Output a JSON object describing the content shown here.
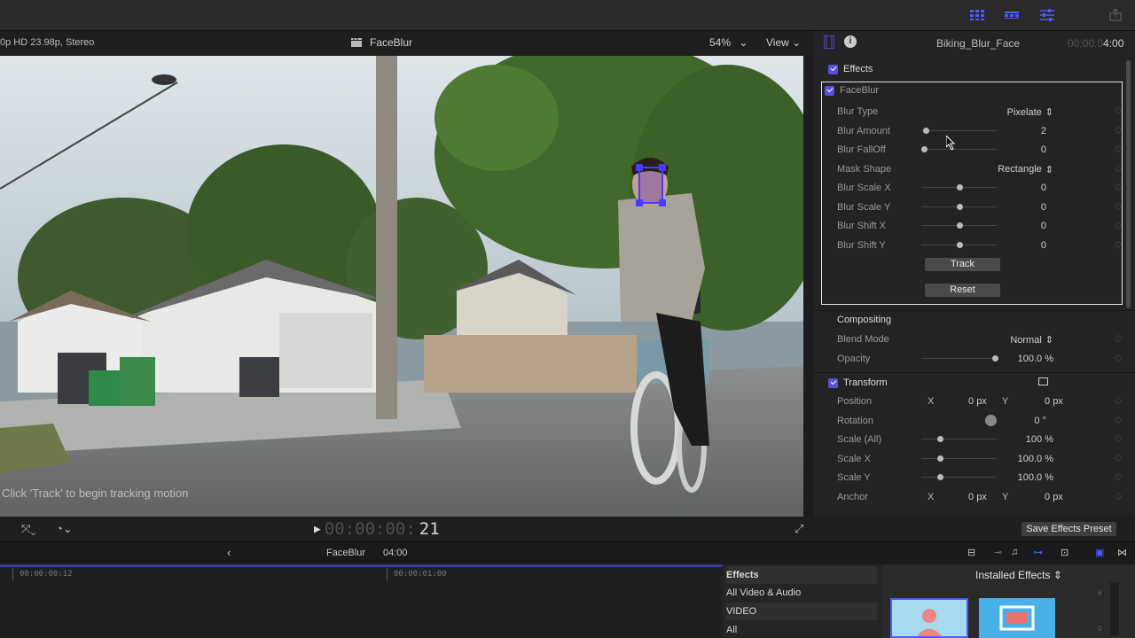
{
  "viewer": {
    "format": "0p HD 23.98p, Stereo",
    "clip_title": "FaceBlur",
    "zoom": "54%",
    "view_label": "View",
    "hint": "Click 'Track' to begin tracking motion",
    "timecode_dim": "00:00:00:",
    "timecode_frames": "21"
  },
  "inspector": {
    "title": "Biking_Blur_Face",
    "duration_dim": "00:00:0",
    "duration": "4:00",
    "effects_label": "Effects",
    "effect_name": "FaceBlur",
    "params": [
      {
        "label": "Blur Type",
        "value": "Pixelate",
        "kind": "popup"
      },
      {
        "label": "Blur Amount",
        "value": "2",
        "kind": "slider",
        "level": 0.02
      },
      {
        "label": "Blur FallOff",
        "value": "0",
        "kind": "slider",
        "level": 0.0
      },
      {
        "label": "Mask Shape",
        "value": "Rectangle",
        "kind": "popup"
      },
      {
        "label": "Blur Scale X",
        "value": "0",
        "kind": "slider",
        "level": 0.5
      },
      {
        "label": "Blur Scale Y",
        "value": "0",
        "kind": "slider",
        "level": 0.5
      },
      {
        "label": "Blur Shift X",
        "value": "0",
        "kind": "slider",
        "level": 0.5
      },
      {
        "label": "Blur Shift Y",
        "value": "0",
        "kind": "slider",
        "level": 0.5
      }
    ],
    "track_label": "Track",
    "reset_label": "Reset",
    "compositing_label": "Compositing",
    "blend_mode_label": "Blend Mode",
    "blend_mode_value": "Normal",
    "opacity_label": "Opacity",
    "opacity_value": "100.0",
    "opacity_unit": "%",
    "transform_label": "Transform",
    "position_label": "Position",
    "position_x_label": "X",
    "position_x": "0",
    "position_y_label": "Y",
    "position_y": "0",
    "px_unit": "px",
    "rotation_label": "Rotation",
    "rotation_value": "0",
    "rotation_unit": "°",
    "scale_all_label": "Scale (All)",
    "scale_all_value": "100",
    "scale_x_label": "Scale X",
    "scale_x_value": "100.0",
    "scale_y_label": "Scale Y",
    "scale_y_value": "100.0",
    "anchor_label": "Anchor",
    "anchor_x_label": "X",
    "anchor_x": "0",
    "anchor_y_label": "Y",
    "anchor_y": "0",
    "percent_unit": "%",
    "save_preset_label": "Save Effects Preset"
  },
  "timeline": {
    "clip_name": "FaceBlur",
    "clip_duration": "04:00",
    "ticks": [
      "00:00:00:12",
      "00:00:01:00"
    ]
  },
  "effects_browser": {
    "header": "Effects",
    "items": [
      "All Video & Audio",
      "VIDEO",
      "All"
    ],
    "installed_label": "Installed Effects"
  },
  "colors": {
    "accent": "#5a4fd8",
    "track_box": "#4a3cff"
  }
}
